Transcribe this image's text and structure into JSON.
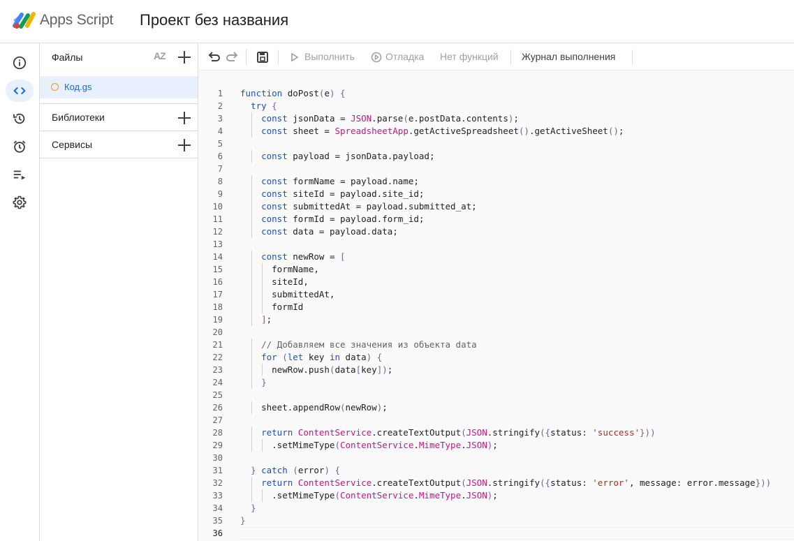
{
  "header": {
    "app_name": "Apps Script",
    "project_title": "Проект без названия"
  },
  "rail": {
    "items": [
      "overview-icon",
      "editor-icon",
      "triggers-history-icon",
      "triggers-icon",
      "executions-icon",
      "settings-icon"
    ]
  },
  "files_panel": {
    "title": "Файлы",
    "sort_icon_text": "AZ",
    "files": [
      {
        "name": "Код.gs"
      }
    ],
    "libraries_label": "Библиотеки",
    "services_label": "Сервисы"
  },
  "toolbar": {
    "run_label": "Выполнить",
    "debug_label": "Отладка",
    "functions_label": "Нет функций",
    "log_label": "Журнал выполнения"
  },
  "editor": {
    "code_lines": [
      "function doPost(e) {",
      "  try {",
      "    const jsonData = JSON.parse(e.postData.contents);",
      "    const sheet = SpreadsheetApp.getActiveSpreadsheet().getActiveSheet();",
      "",
      "    const payload = jsonData.payload;",
      "",
      "    const formName = payload.name;",
      "    const siteId = payload.site_id;",
      "    const submittedAt = payload.submitted_at;",
      "    const formId = payload.form_id;",
      "    const data = payload.data;",
      "",
      "    const newRow = [",
      "      formName,",
      "      siteId,",
      "      submittedAt,",
      "      formId",
      "    ];",
      "",
      "    // Добавляем все значения из объекта data",
      "    for (let key in data) {",
      "      newRow.push(data[key]);",
      "    }",
      "",
      "    sheet.appendRow(newRow);",
      "",
      "    return ContentService.createTextOutput(JSON.stringify({status: 'success'}))",
      "      .setMimeType(ContentService.MimeType.JSON);",
      "",
      "  } catch (error) {",
      "    return ContentService.createTextOutput(JSON.stringify({status: 'error', message: error.message}))",
      "      .setMimeType(ContentService.MimeType.JSON);",
      "  }",
      "}",
      ""
    ]
  },
  "colors": {
    "accent": "#1967d2",
    "active_bg": "#e8f0fe",
    "keyword": "#1a4fc9",
    "class_name": "#c71585",
    "string": "#b52a1d",
    "file_dot": "#f29900"
  }
}
